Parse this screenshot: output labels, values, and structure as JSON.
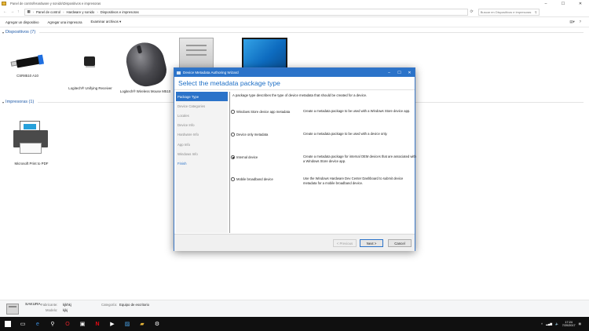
{
  "explorer": {
    "title": "Panel de control\\Hardware y sonido\\Dispositivos e impresoras",
    "breadcrumb": [
      "Panel de control",
      "Hardware y sonido",
      "Dispositivos e impresoras"
    ],
    "search_placeholder": "Buscar en Dispositivos e impresoras",
    "commands": [
      "Agregar un dispositivo",
      "Agregar una impresora",
      "Examinar archivos ▾"
    ]
  },
  "groups": {
    "devices": {
      "label": "Dispositivos (7)"
    },
    "printers": {
      "label": "Impresoras (1)"
    }
  },
  "devices": [
    {
      "label": "CSR8510 A10",
      "icon": "usb-stick-icon"
    },
    {
      "label": "Logitech® Unifying Receiver",
      "icon": "usb-receiver-icon"
    },
    {
      "label": "Logitech® Wireless Mouse M510",
      "icon": "mouse-icon"
    }
  ],
  "printers": [
    {
      "label": "Microsoft Print to PDF",
      "icon": "printer-icon"
    }
  ],
  "details": {
    "name": "SAKURA",
    "fabricante_label": "Fabricante:",
    "fabricante_value": "kjkhkj",
    "modelo_label": "Modelo:",
    "modelo_value": "kjkj",
    "categoria_label": "Categoría:",
    "categoria_value": "Equipo de escritorio"
  },
  "taskbar": {
    "time": "17:24",
    "date": "7/20/2017",
    "icons": [
      "windows-start-icon",
      "task-view-icon",
      "edge-icon",
      "search-icon",
      "opera-icon",
      "store-icon",
      "netflix-icon",
      "media-icon",
      "photos-icon",
      "explorer-icon",
      "settings-icon"
    ]
  },
  "wizard": {
    "window_title": "Device Metadata Authoring Wizard",
    "heading": "Select the metadata package type",
    "steps": [
      "Package Type",
      "Device Categories",
      "Locales",
      "Device Info",
      "Hardware Info",
      "App Info",
      "Windows Info",
      "Finish"
    ],
    "active_step": 0,
    "description": "A package type describes the type of device metadata that should be created for a device.",
    "options": [
      {
        "label": "Windows Store device app metadata",
        "description": "Create a metadata package to be used with a Windows Store device app.",
        "selected": false
      },
      {
        "label": "Device only metadata",
        "description": "Create a metadata package to be used with a device only.",
        "selected": false
      },
      {
        "label": "Internal device",
        "description": "Create a metadata package for internal OEM devices that are associated with a Windows Store device app.",
        "selected": true
      },
      {
        "label": "Mobile broadband device",
        "description": "Use the Windows Hardware Dev Center Dashboard to submit device metadata for a mobile broadband device.",
        "selected": false
      }
    ],
    "buttons": {
      "previous": "< Previous",
      "next": "Next >",
      "cancel": "Cancel"
    }
  },
  "colors": {
    "accent": "#2b73c9",
    "group_header": "#1e5aa8",
    "taskbar": "#101010"
  }
}
